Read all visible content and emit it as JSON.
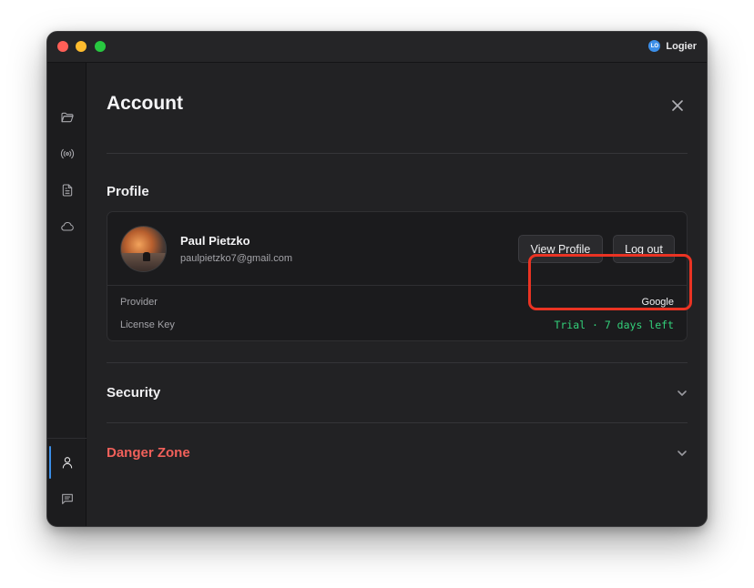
{
  "app": {
    "name": "Logier",
    "logo_text": "LO"
  },
  "sidebar": {
    "items": [
      {
        "icon": "folder-icon"
      },
      {
        "icon": "broadcast-icon"
      },
      {
        "icon": "document-icon"
      },
      {
        "icon": "cloud-icon"
      },
      {
        "icon": "user-icon",
        "active": true
      },
      {
        "icon": "message-icon"
      },
      {
        "icon": "settings-icon"
      }
    ]
  },
  "page": {
    "title": "Account"
  },
  "profile": {
    "section_title": "Profile",
    "name": "Paul Pietzko",
    "email": "paulpietzko7@gmail.com",
    "view_profile_label": "View Profile",
    "logout_label": "Log out",
    "provider_label": "Provider",
    "provider_value": "Google",
    "license_label": "License Key",
    "license_value": "Trial · 7 days left"
  },
  "security": {
    "title": "Security"
  },
  "danger_zone": {
    "title": "Danger Zone",
    "color": "#f0605a"
  },
  "colors": {
    "accent": "#3b8ee8",
    "license_green": "#33d17a",
    "highlight_red": "#ea3323"
  }
}
